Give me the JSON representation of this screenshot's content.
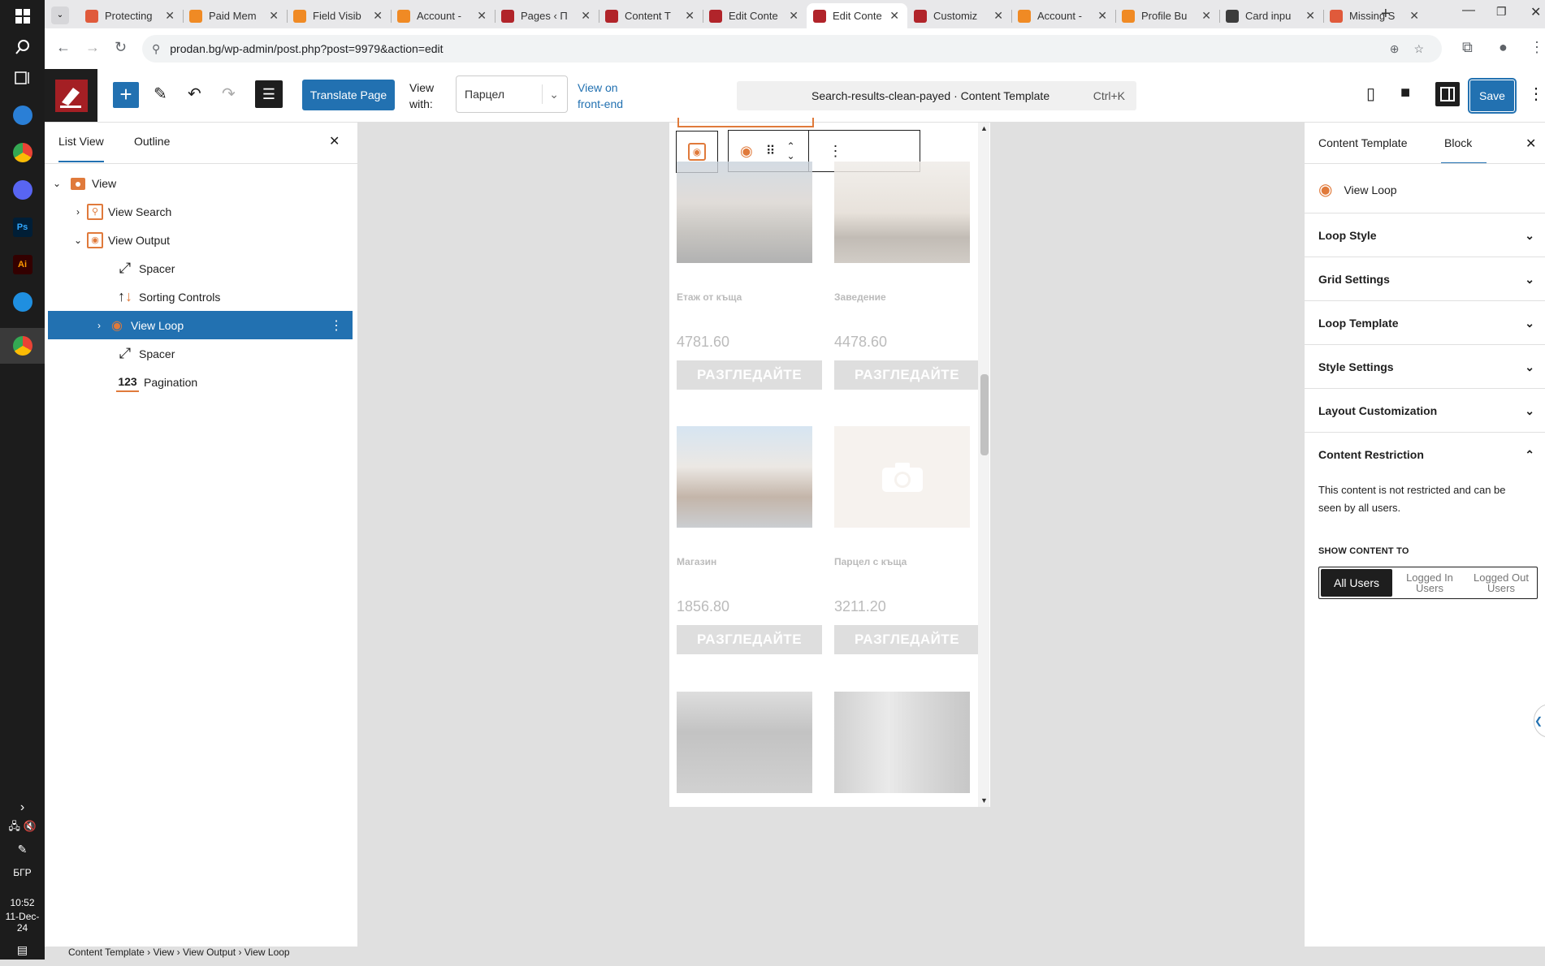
{
  "taskbar": {
    "time": "10:52",
    "date": "11-Dec-24",
    "lang": "БГР"
  },
  "browser": {
    "tabs": [
      {
        "title": "Protecting",
        "fav": "#e05a3b"
      },
      {
        "title": "Paid Mem",
        "fav": "#f08a24"
      },
      {
        "title": "Field Visib",
        "fav": "#f08a24"
      },
      {
        "title": "Account -",
        "fav": "#f08a24"
      },
      {
        "title": "Pages ‹ П",
        "fav": "#b1242a"
      },
      {
        "title": "Content T",
        "fav": "#b1242a"
      },
      {
        "title": "Edit Conte",
        "fav": "#b1242a"
      },
      {
        "title": "Edit Conte",
        "fav": "#b1242a"
      },
      {
        "title": "Customiz",
        "fav": "#b1242a"
      },
      {
        "title": "Account -",
        "fav": "#f08a24"
      },
      {
        "title": "Profile Bu",
        "fav": "#f08a24"
      },
      {
        "title": "Card inpu",
        "fav": "#3c3c3c"
      },
      {
        "title": "Missing S",
        "fav": "#e05a3b"
      }
    ],
    "url": "prodan.bg/wp-admin/post.php?post=9979&action=edit"
  },
  "editor": {
    "translate_label": "Translate Page",
    "view_with_label": "View with:",
    "view_with_value": "Парцел",
    "view_front_label": "View on front-end",
    "doc_title": "Search-results-clean-payed · Content Template",
    "shortcut": "Ctrl+K",
    "save_label": "Save"
  },
  "left_panel": {
    "tab_list": "List View",
    "tab_outline": "Outline",
    "tree": [
      {
        "label": "View",
        "icon": "view-icon"
      },
      {
        "label": "View Search",
        "icon": "search-icon"
      },
      {
        "label": "View Output",
        "icon": "eye-icon"
      },
      {
        "label": "Spacer",
        "icon": "resize-icon"
      },
      {
        "label": "Sorting Controls",
        "icon": "sort-icon"
      },
      {
        "label": "View Loop",
        "icon": "loop-icon"
      },
      {
        "label": "Spacer",
        "icon": "resize-icon"
      },
      {
        "label": "Pagination",
        "icon": "pagination-icon"
      }
    ]
  },
  "canvas": {
    "cards": [
      {
        "title": "Етаж от къща",
        "price": "4781.60",
        "button": "РАЗГЛЕДАЙТЕ"
      },
      {
        "title": "Заведение",
        "price": "4478.60",
        "button": "РАЗГЛЕДАЙТЕ"
      },
      {
        "title": "Магазин",
        "price": "1856.80",
        "button": "РАЗГЛЕДАЙТЕ"
      },
      {
        "title": "Парцел с къща",
        "price": "3211.20",
        "button": "РАЗГЛЕДАЙТЕ"
      }
    ]
  },
  "right_panel": {
    "tab_template": "Content Template",
    "tab_block": "Block",
    "block_name": "View Loop",
    "sections": [
      "Loop Style",
      "Grid Settings",
      "Loop Template",
      "Style Settings",
      "Layout Customization",
      "Content Restriction"
    ],
    "restriction_text": "This content is not restricted and can be seen by all users.",
    "show_to_label": "SHOW CONTENT TO",
    "options": [
      "All Users",
      "Logged In Users",
      "Logged Out Users"
    ]
  },
  "breadcrumb": "Content Template › View › View Output › View Loop"
}
